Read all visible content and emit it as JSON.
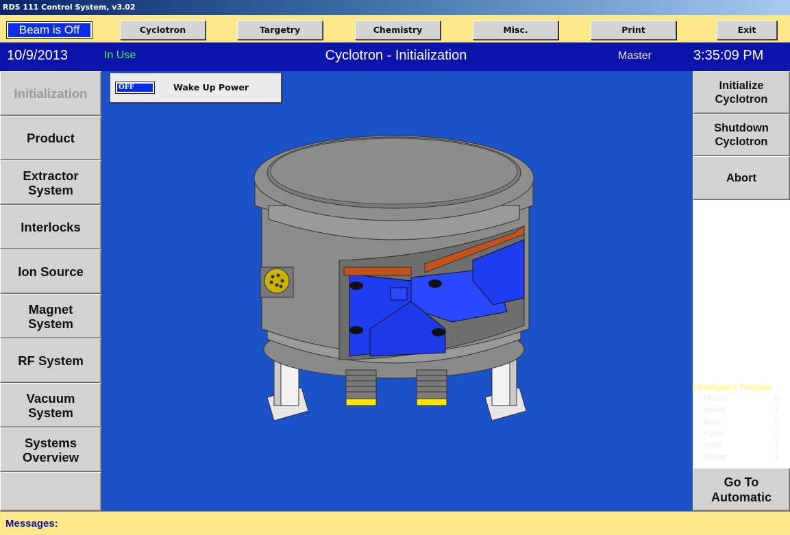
{
  "window": {
    "title": "RDS 111 Control System, v3.02"
  },
  "top_bar": {
    "beam_status": "Beam is Off",
    "buttons": [
      "Cyclotron",
      "Targetry",
      "Chemistry",
      "Misc.",
      "Print",
      "Exit"
    ]
  },
  "status_bar": {
    "date": "10/9/2013",
    "use_state": "In Use",
    "page_title": "Cyclotron - Initialization",
    "role": "Master",
    "time": "3:35:09 PM"
  },
  "left_nav": [
    {
      "label": "Initialization",
      "disabled": true
    },
    {
      "label": "Product"
    },
    {
      "label": "Extractor\nSystem"
    },
    {
      "label": "Interlocks"
    },
    {
      "label": "Ion Source"
    },
    {
      "label": "Magnet\nSystem"
    },
    {
      "label": "RF System"
    },
    {
      "label": "Vacuum\nSystem"
    },
    {
      "label": "Systems\nOverview"
    },
    {
      "label": ""
    }
  ],
  "right_actions": {
    "initialize": "Initialize\nCyclotron",
    "shutdown": "Shutdown\nCyclotron",
    "abort": "Abort",
    "automatic": "Go To\nAutomatic"
  },
  "wake_up": {
    "state": "OFF",
    "label": "Wake Up Power"
  },
  "developer_treasure": {
    "title": "Developer's Treasure",
    "rows": [
      {
        "key": "Picture",
        "value": "0"
      },
      {
        "key": "omode",
        "value": "1"
      },
      {
        "key": "Busy",
        "value": "0"
      },
      {
        "key": "Inproc",
        "value": "0"
      },
      {
        "key": "Inuse",
        "value": "1"
      },
      {
        "key": "Master",
        "value": "1"
      }
    ]
  },
  "messages": {
    "label": "Messages:"
  },
  "colors": {
    "panel_blue": "#1c52c8",
    "status_blue": "#0a14a8",
    "yellow_bar": "#ffe88a",
    "in_use_green": "#39ff39",
    "dev_title_yellow": "#ffff40"
  }
}
